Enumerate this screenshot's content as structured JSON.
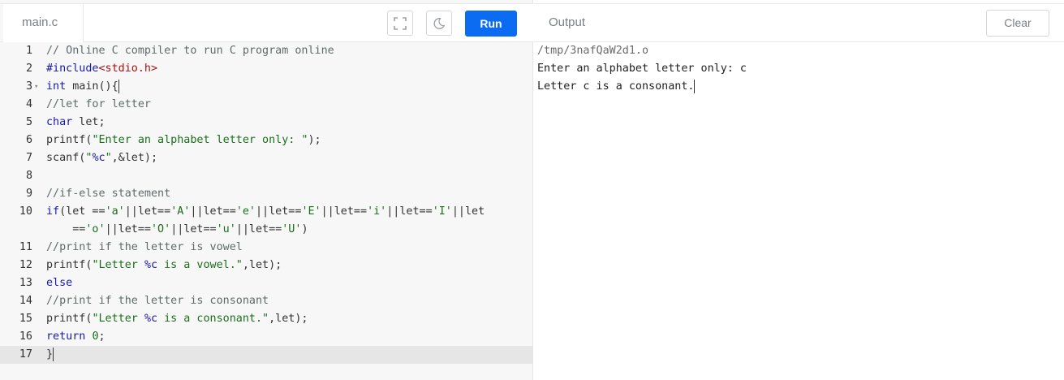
{
  "editor": {
    "file_tab": "main.c",
    "run_label": "Run",
    "lines": [
      {
        "n": "1",
        "fold": "",
        "tokens": [
          {
            "t": "// Online C compiler to run C program online",
            "c": "com"
          }
        ]
      },
      {
        "n": "2",
        "fold": "",
        "tokens": [
          {
            "t": "#include",
            "c": "key"
          },
          {
            "t": "<stdio.h>",
            "c": "inc"
          }
        ]
      },
      {
        "n": "3",
        "fold": "▾",
        "tokens": [
          {
            "t": "int",
            "c": "key"
          },
          {
            "t": " main(){",
            "c": ""
          }
        ],
        "cursor_end": true
      },
      {
        "n": "4",
        "fold": "",
        "tokens": [
          {
            "t": "//let for letter",
            "c": "com"
          }
        ]
      },
      {
        "n": "5",
        "fold": "",
        "tokens": [
          {
            "t": "char",
            "c": "key"
          },
          {
            "t": " let;",
            "c": ""
          }
        ]
      },
      {
        "n": "6",
        "fold": "",
        "tokens": [
          {
            "t": "printf(",
            "c": ""
          },
          {
            "t": "\"Enter an alphabet letter only: \"",
            "c": "str"
          },
          {
            "t": ");",
            "c": ""
          }
        ]
      },
      {
        "n": "7",
        "fold": "",
        "tokens": [
          {
            "t": "scanf(",
            "c": ""
          },
          {
            "t": "\"",
            "c": "str"
          },
          {
            "t": "%c",
            "c": "fmt"
          },
          {
            "t": "\"",
            "c": "str"
          },
          {
            "t": ",&let);",
            "c": ""
          }
        ]
      },
      {
        "n": "8",
        "fold": "",
        "tokens": []
      },
      {
        "n": "9",
        "fold": "",
        "tokens": [
          {
            "t": "//if-else statement",
            "c": "com"
          }
        ]
      },
      {
        "n": "10",
        "fold": "",
        "tokens": [
          {
            "t": "if",
            "c": "key"
          },
          {
            "t": "(let ==",
            "c": ""
          },
          {
            "t": "'a'",
            "c": "str"
          },
          {
            "t": "||let==",
            "c": ""
          },
          {
            "t": "'A'",
            "c": "str"
          },
          {
            "t": "||let==",
            "c": ""
          },
          {
            "t": "'e'",
            "c": "str"
          },
          {
            "t": "||let==",
            "c": ""
          },
          {
            "t": "'E'",
            "c": "str"
          },
          {
            "t": "||let==",
            "c": ""
          },
          {
            "t": "'i'",
            "c": "str"
          },
          {
            "t": "||let==",
            "c": ""
          },
          {
            "t": "'I'",
            "c": "str"
          },
          {
            "t": "||let",
            "c": ""
          }
        ]
      },
      {
        "n": "",
        "fold": "",
        "tokens": [
          {
            "t": "    ==",
            "c": ""
          },
          {
            "t": "'o'",
            "c": "str"
          },
          {
            "t": "||let==",
            "c": ""
          },
          {
            "t": "'O'",
            "c": "str"
          },
          {
            "t": "||let==",
            "c": ""
          },
          {
            "t": "'u'",
            "c": "str"
          },
          {
            "t": "||let==",
            "c": ""
          },
          {
            "t": "'U'",
            "c": "str"
          },
          {
            "t": ")",
            "c": ""
          }
        ]
      },
      {
        "n": "11",
        "fold": "",
        "tokens": [
          {
            "t": "//print if the letter is vowel",
            "c": "com"
          }
        ]
      },
      {
        "n": "12",
        "fold": "",
        "tokens": [
          {
            "t": "printf(",
            "c": ""
          },
          {
            "t": "\"Letter ",
            "c": "str"
          },
          {
            "t": "%c",
            "c": "fmt"
          },
          {
            "t": " is a vowel.\"",
            "c": "str"
          },
          {
            "t": ",let);",
            "c": ""
          }
        ]
      },
      {
        "n": "13",
        "fold": "",
        "tokens": [
          {
            "t": "else",
            "c": "key"
          }
        ]
      },
      {
        "n": "14",
        "fold": "",
        "tokens": [
          {
            "t": "//print if the letter is consonant",
            "c": "com"
          }
        ]
      },
      {
        "n": "15",
        "fold": "",
        "tokens": [
          {
            "t": "printf(",
            "c": ""
          },
          {
            "t": "\"Letter ",
            "c": "str"
          },
          {
            "t": "%c",
            "c": "fmt"
          },
          {
            "t": " is a consonant.\"",
            "c": "str"
          },
          {
            "t": ",let);",
            "c": ""
          }
        ]
      },
      {
        "n": "16",
        "fold": "",
        "tokens": [
          {
            "t": "return",
            "c": "key"
          },
          {
            "t": " ",
            "c": ""
          },
          {
            "t": "0",
            "c": "num"
          },
          {
            "t": ";",
            "c": ""
          }
        ]
      },
      {
        "n": "17",
        "fold": "",
        "tokens": [
          {
            "t": "}",
            "c": ""
          }
        ],
        "active": true,
        "cursor_end": true
      }
    ]
  },
  "output": {
    "title": "Output",
    "clear_label": "Clear",
    "lines": [
      {
        "text": "/tmp/3nafQaW2d1.o",
        "kind": "path"
      },
      {
        "text": "Enter an alphabet letter only: c",
        "kind": "text"
      },
      {
        "text": "Letter c is a consonant.",
        "kind": "text",
        "cursor": true
      }
    ]
  },
  "colors": {
    "run_button": "#0b6cf2",
    "keyword": "#1a1aa6",
    "string": "#1a6e1a",
    "include": "#aa1111",
    "comment": "#5f6b6b"
  }
}
